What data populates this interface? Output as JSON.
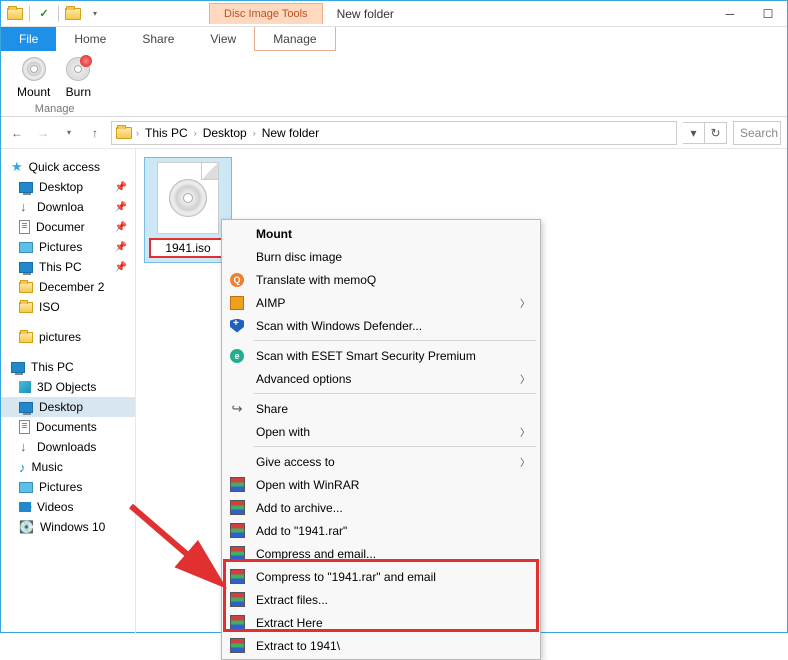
{
  "title": "New folder",
  "context_tab": "Disc Image Tools",
  "ribbon": {
    "file": "File",
    "tabs": [
      "Home",
      "Share",
      "View"
    ],
    "ctx_tab": "Manage",
    "group": {
      "mount": "Mount",
      "burn": "Burn",
      "label": "Manage"
    }
  },
  "breadcrumb": [
    "This PC",
    "Desktop",
    "New folder"
  ],
  "search_placeholder": "Search",
  "sidebar": {
    "quick": "Quick access",
    "qitems": [
      "Desktop",
      "Downloa",
      "Documer",
      "Pictures",
      "This PC",
      "December 2",
      "ISO",
      "pictures"
    ],
    "thispc": "This PC",
    "pcitems": [
      "3D Objects",
      "Desktop",
      "Documents",
      "Downloads",
      "Music",
      "Pictures",
      "Videos",
      "Windows 10"
    ]
  },
  "file": {
    "name": "1941.iso"
  },
  "menu": {
    "mount": "Mount",
    "burn": "Burn disc image",
    "memoq": "Translate with memoQ",
    "aimp": "AIMP",
    "defender": "Scan with Windows Defender...",
    "eset": "Scan with ESET Smart Security Premium",
    "adv": "Advanced options",
    "share": "Share",
    "openwith": "Open with",
    "giveaccess": "Give access to",
    "openrar": "Open with WinRAR",
    "addarch": "Add to archive...",
    "addto": "Add to \"1941.rar\"",
    "compemail": "Compress and email...",
    "comptoemail": "Compress to \"1941.rar\" and email",
    "extfiles": "Extract files...",
    "exthere": "Extract Here",
    "extto": "Extract to 1941\\"
  }
}
